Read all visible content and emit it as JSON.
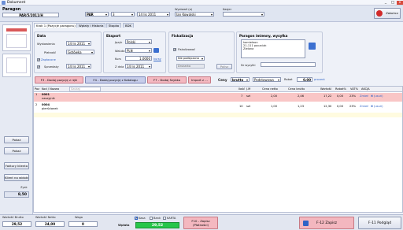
{
  "window": {
    "title": "Dokument",
    "min": "_",
    "max": "□",
    "close": "x"
  },
  "header": {
    "doc_type": "Paragon",
    "doc_number": "PAR/5/2011/H",
    "series": "PAR",
    "number": "3",
    "date": "14 lis 2011",
    "issuer_label": "Wystawił (a)",
    "issuer": "Jan Kowalski",
    "cashier_label": "Kasjer",
    "cashier": "",
    "close_label": "Zakończ"
  },
  "tabs": [
    {
      "label": "Krok 1 (Pozycje paragonu)"
    },
    {
      "label": "Wpłaty i Historia"
    },
    {
      "label": "Stopka"
    },
    {
      "label": "BDK"
    }
  ],
  "data_panel": {
    "title": "Data",
    "issue_label": "Wystawienia",
    "issue_date": "14 lis 2011",
    "payment_label": "Płatność",
    "payment": "Gotówka",
    "paid_label": "Zapłacone",
    "sale_label": "Sprzedaży",
    "sale_date": "14 lis 2011"
  },
  "export_panel": {
    "title": "Eksport",
    "lang_label": "Język",
    "lang": "Polski",
    "currency_label": "Waluta",
    "currency": "PLN",
    "rate_label": "Kurs",
    "rate": "1,0000",
    "rate_link": "kursy",
    "date_label": "Z dnia",
    "date": "14 lis 2011"
  },
  "fiscal_panel": {
    "title": "Fiskalizacja",
    "fiscal_label": "Fiskalizować",
    "fiscal_checked": "✔",
    "status": "Nie podłączona",
    "printer": "Drukarka",
    "kasa_btn": "Polisz"
  },
  "receipt_panel": {
    "title": "Paragon imienny, wysyłka",
    "lines": [
      "kamieleon",
      "21-111 poczciak",
      "Zielona"
    ],
    "nip_label": "Nr wysyłki",
    "nip": ""
  },
  "toolbar": {
    "add_manual": "F3 - Dodaj pozycję z ręki",
    "add_catalog": "F4 - Dodaj pozycję z Katalogu",
    "add_quick": "F7 - Dodaj Szybko",
    "import": "Import z ...",
    "prices_label": "Ceny",
    "prices_mode": "brutto",
    "price_type": "Podstawowa",
    "discount_label": "Rabat",
    "discount": "0,00",
    "discount_unit": "procent"
  },
  "grid": {
    "columns": [
      "Poz",
      "Kod / Nazwa",
      "Szukaj",
      "Ilość",
      "J.M",
      "Cena netto",
      "Cena brutto",
      "Wartość",
      "Rabat%",
      "VAT%",
      "AKCJA"
    ],
    "rows": [
      {
        "poz": "1",
        "kod": "0001",
        "nazwa": "naszyjnik",
        "ilosc": "7",
        "jm": "szt",
        "netto": "2,00",
        "brutto": "2,46",
        "wartosc": "17,22",
        "rabat": "0,00",
        "vat": "23%",
        "a1": "Zmień",
        "a2": "(usuń)"
      },
      {
        "poz": "2",
        "kod": "0004",
        "nazwa": "pierścionek",
        "ilosc": "10",
        "jm": "szt",
        "netto": "1,00",
        "brutto": "1,23",
        "wartosc": "12,30",
        "rabat": "0,00",
        "vat": "23%",
        "a1": "Zmień",
        "a2": "(usuń)"
      }
    ]
  },
  "sidebar": {
    "pokaz1": "Pokaż",
    "pokaz2": "Pokaż",
    "faktury": "Faktury klienta",
    "klient": "Klient na widoku",
    "zysk_label": "Zysk",
    "zysk": "8,50"
  },
  "footer": {
    "brutto_label": "Wartość Brutto",
    "brutto": "29,52",
    "netto_label": "Wartość Netto",
    "netto": "24,00",
    "waga_label": "Waga",
    "waga": "0",
    "cb_kasa": "Kasa",
    "cb_bank": "Bank",
    "cb_karta": "KARTA",
    "wplata_label": "Wpłata",
    "wplata": "29,52",
    "f10": "F10 - Zapisz",
    "f10b": "(Płatności)",
    "f12": "F-12 Zapisz",
    "f11": "F-11 Podgląd"
  },
  "colors": {
    "accent": "#2f63c6",
    "danger": "#d12a2a",
    "row_selected": "#f9c6c6",
    "button_f3": "#f4b8c0"
  }
}
